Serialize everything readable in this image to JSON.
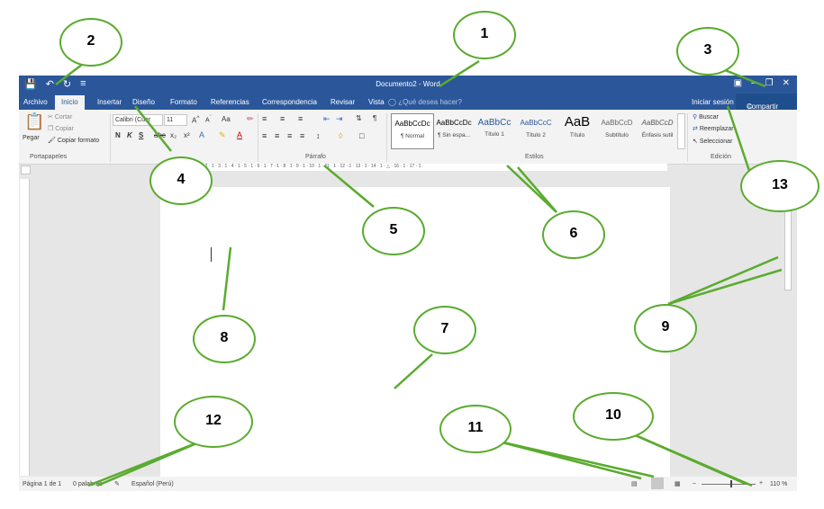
{
  "title_bar": {
    "document_title": "Documento2 - Word",
    "save_icon": "save-icon",
    "undo_icon": "undo-icon",
    "redo_icon": "redo-icon"
  },
  "tabs": [
    "Archivo",
    "Inicio",
    "Insertar",
    "Diseño",
    "Formato",
    "Referencias",
    "Correspondencia",
    "Revisar",
    "Vista"
  ],
  "tell_me": "¿Qué desea hacer?",
  "signin": "Iniciar sesión",
  "share": "Compartir",
  "clipboard": {
    "paste": "Pegar",
    "cut": "Cortar",
    "copy": "Copiar",
    "format_painter": "Copiar formato",
    "label": "Portapapeles"
  },
  "font": {
    "name": "Calibri (Cuer",
    "size": "11",
    "change_case": "Aa",
    "bold": "N",
    "italic": "K",
    "underline": "S",
    "sub": "x₂",
    "sup": "x²"
  },
  "paragraph": {
    "label": "Párrafo"
  },
  "styles": {
    "label": "Estilos",
    "items": [
      {
        "sample": "AaBbCcDc",
        "name": "¶ Normal"
      },
      {
        "sample": "AaBbCcDc",
        "name": "¶ Sin espa..."
      },
      {
        "sample": "AaBbCc",
        "name": "Título 1"
      },
      {
        "sample": "AaBbCcC",
        "name": "Título 2"
      },
      {
        "sample": "AaB",
        "name": "Título"
      },
      {
        "sample": "AaBbCcD",
        "name": "Subtítulo"
      },
      {
        "sample": "AaBbCcD",
        "name": "Énfasis sutil"
      }
    ]
  },
  "editing": {
    "find": "Buscar",
    "replace": "Reemplazar",
    "select": "Seleccionar",
    "label": "Edición"
  },
  "status": {
    "page": "Página 1 de 1",
    "words": "0 palabras",
    "language": "Español (Perú)",
    "zoom": "110 %"
  },
  "ruler": "· 1 · 2 · 1 · 1 · ␣ · 1 · 2 · 1 · 3 · 1 · 4 · 1 · 5 · 1 · 6 · 1 · 7 · 1 · 8 · 1 · 9 · 1 · 10 · 1 · 11 · 1 · 12 · 1 · 13 · 1 · 14 · 1 · △ · 16 · 1 · 17 · 1",
  "callouts": [
    "1",
    "2",
    "3",
    "4",
    "5",
    "6",
    "7",
    "8",
    "9",
    "10",
    "11",
    "12",
    "13"
  ],
  "accent": "#2b579a",
  "callout_color": "#5aab2f"
}
